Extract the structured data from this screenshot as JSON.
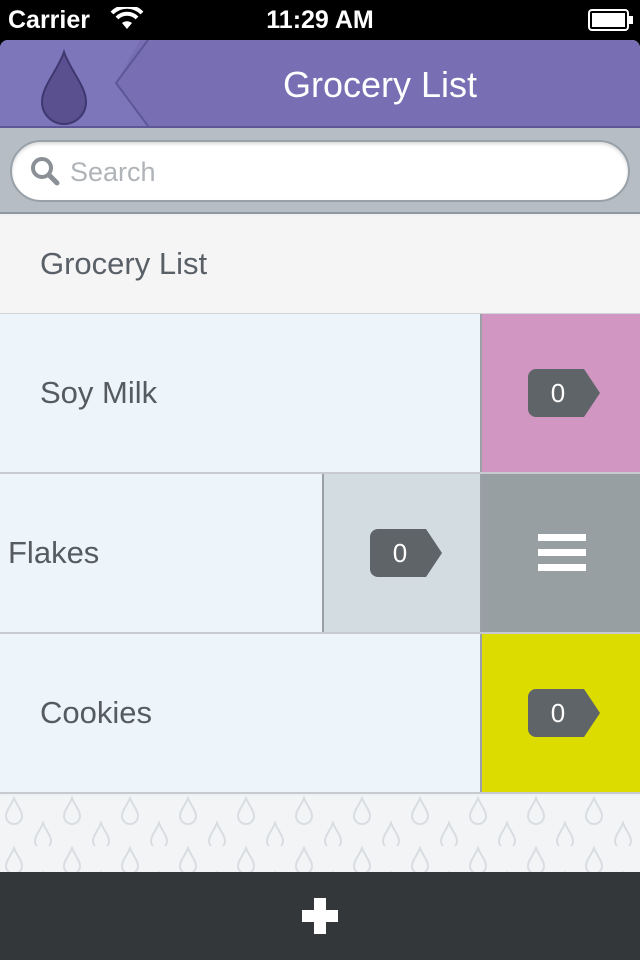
{
  "status_bar": {
    "carrier": "Carrier",
    "time": "11:29 AM"
  },
  "nav": {
    "title": "Grocery List",
    "accent_color": "#776eb3",
    "logo_icon": "drop-icon"
  },
  "search": {
    "placeholder": "Search",
    "value": ""
  },
  "list": {
    "header": "Grocery List",
    "items": [
      {
        "label": "Soy Milk",
        "count": "0",
        "color": "#d296c2"
      },
      {
        "label": "Flakes",
        "count": "0",
        "color": "#d3dde1",
        "swiped": true
      },
      {
        "label": "Cookies",
        "count": "0",
        "color": "#dcdc00"
      }
    ]
  },
  "actions": {
    "add_icon": "plus-icon",
    "reorder_icon": "menu-icon"
  }
}
